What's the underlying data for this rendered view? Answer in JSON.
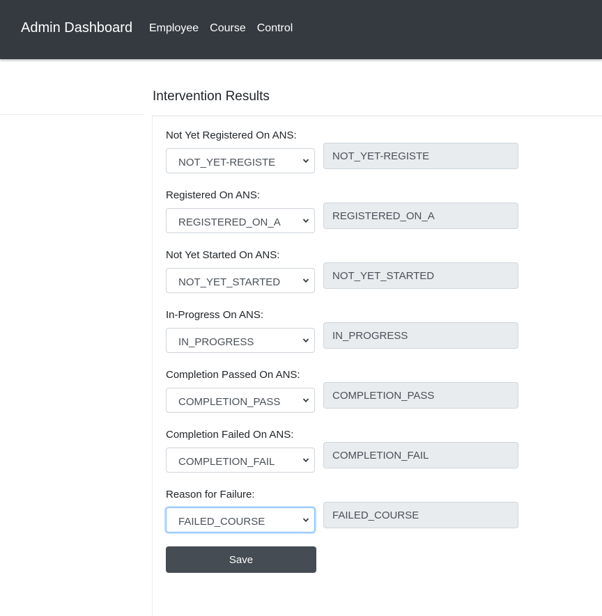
{
  "navbar": {
    "brand": "Admin Dashboard",
    "links": [
      "Employee",
      "Course",
      "Control"
    ]
  },
  "page": {
    "title": "Intervention Results"
  },
  "fields": [
    {
      "label": "Not Yet Registered On ANS:",
      "selected": "NOT_YET-REGISTE",
      "value": "NOT_YET-REGISTE"
    },
    {
      "label": "Registered On ANS:",
      "selected": "REGISTERED_ON_A",
      "value": "REGISTERED_ON_A"
    },
    {
      "label": "Not Yet Started On ANS:",
      "selected": "NOT_YET_STARTED",
      "value": "NOT_YET_STARTED"
    },
    {
      "label": "In-Progress On ANS:",
      "selected": "IN_PROGRESS",
      "value": "IN_PROGRESS"
    },
    {
      "label": "Completion Passed On ANS:",
      "selected": "COMPLETION_PASS",
      "value": "COMPLETION_PASS"
    },
    {
      "label": "Completion Failed On ANS:",
      "selected": "COMPLETION_FAIL",
      "value": "COMPLETION_FAIL"
    },
    {
      "label": "Reason for Failure:",
      "selected": "FAILED_COURSE",
      "value": "FAILED_COURSE"
    }
  ],
  "actions": {
    "save_label": "Save"
  },
  "colors": {
    "navbar_bg": "#343a40",
    "readonly_bg": "#e9ecef",
    "button_bg": "#454c53",
    "focus_ring": "#80bdff"
  }
}
